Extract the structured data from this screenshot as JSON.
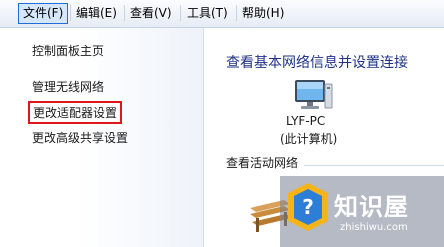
{
  "menubar": {
    "items": [
      {
        "label": "文件(F)"
      },
      {
        "label": "编辑(E)"
      },
      {
        "label": "查看(V)"
      },
      {
        "label": "工具(T)"
      },
      {
        "label": "帮助(H)"
      }
    ]
  },
  "sidebar": {
    "items": [
      {
        "label": "控制面板主页"
      },
      {
        "label": "管理无线网络"
      },
      {
        "label": "更改适配器设置"
      },
      {
        "label": "更改高级共享设置"
      }
    ]
  },
  "main": {
    "heading": "查看基本网络信息并设置连接",
    "computer": {
      "name": "LYF-PC",
      "subtitle": "(此计算机)",
      "icon": "computer-icon"
    },
    "active_section": "查看活动网络",
    "network_icon": "bench-icon"
  },
  "watermark": {
    "title": "知识屋",
    "url": "zhishiwu.com"
  },
  "colors": {
    "highlight_border": "#e0161b",
    "heading": "#1e3287",
    "menu_active_border": "#1c6fd6"
  }
}
